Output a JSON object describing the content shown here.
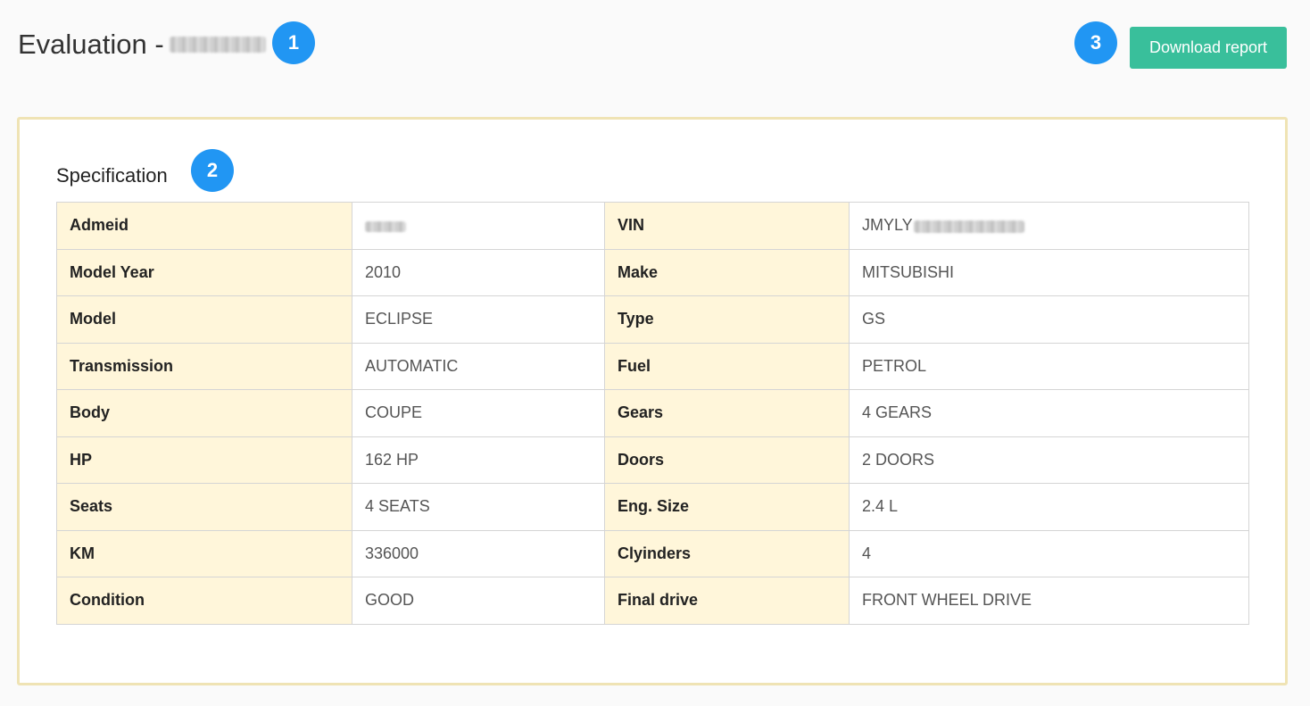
{
  "header": {
    "title_prefix": "Evaluation -",
    "download_label": "Download report"
  },
  "badges": {
    "one": "1",
    "two": "2",
    "three": "3"
  },
  "specification": {
    "title": "Specification",
    "rows": [
      {
        "label1": "Admeid",
        "value1": "",
        "label2": "VIN",
        "value2": "JMYLY"
      },
      {
        "label1": "Model Year",
        "value1": "2010",
        "label2": "Make",
        "value2": "MITSUBISHI"
      },
      {
        "label1": "Model",
        "value1": "ECLIPSE",
        "label2": "Type",
        "value2": "GS"
      },
      {
        "label1": "Transmission",
        "value1": "AUTOMATIC",
        "label2": "Fuel",
        "value2": "PETROL"
      },
      {
        "label1": "Body",
        "value1": "COUPE",
        "label2": "Gears",
        "value2": "4 GEARS"
      },
      {
        "label1": "HP",
        "value1": "162 HP",
        "label2": "Doors",
        "value2": "2 DOORS"
      },
      {
        "label1": "Seats",
        "value1": "4 SEATS",
        "label2": "Eng. Size",
        "value2": "2.4 L"
      },
      {
        "label1": "KM",
        "value1": "336000",
        "label2": "Clyinders",
        "value2": "4"
      },
      {
        "label1": "Condition",
        "value1": "GOOD",
        "label2": "Final drive",
        "value2": "FRONT WHEEL DRIVE"
      }
    ]
  },
  "colors": {
    "accent_button": "#39bf9b",
    "badge": "#2196f3",
    "label_cell": "#fff6da",
    "card_border": "#efe3b4"
  }
}
